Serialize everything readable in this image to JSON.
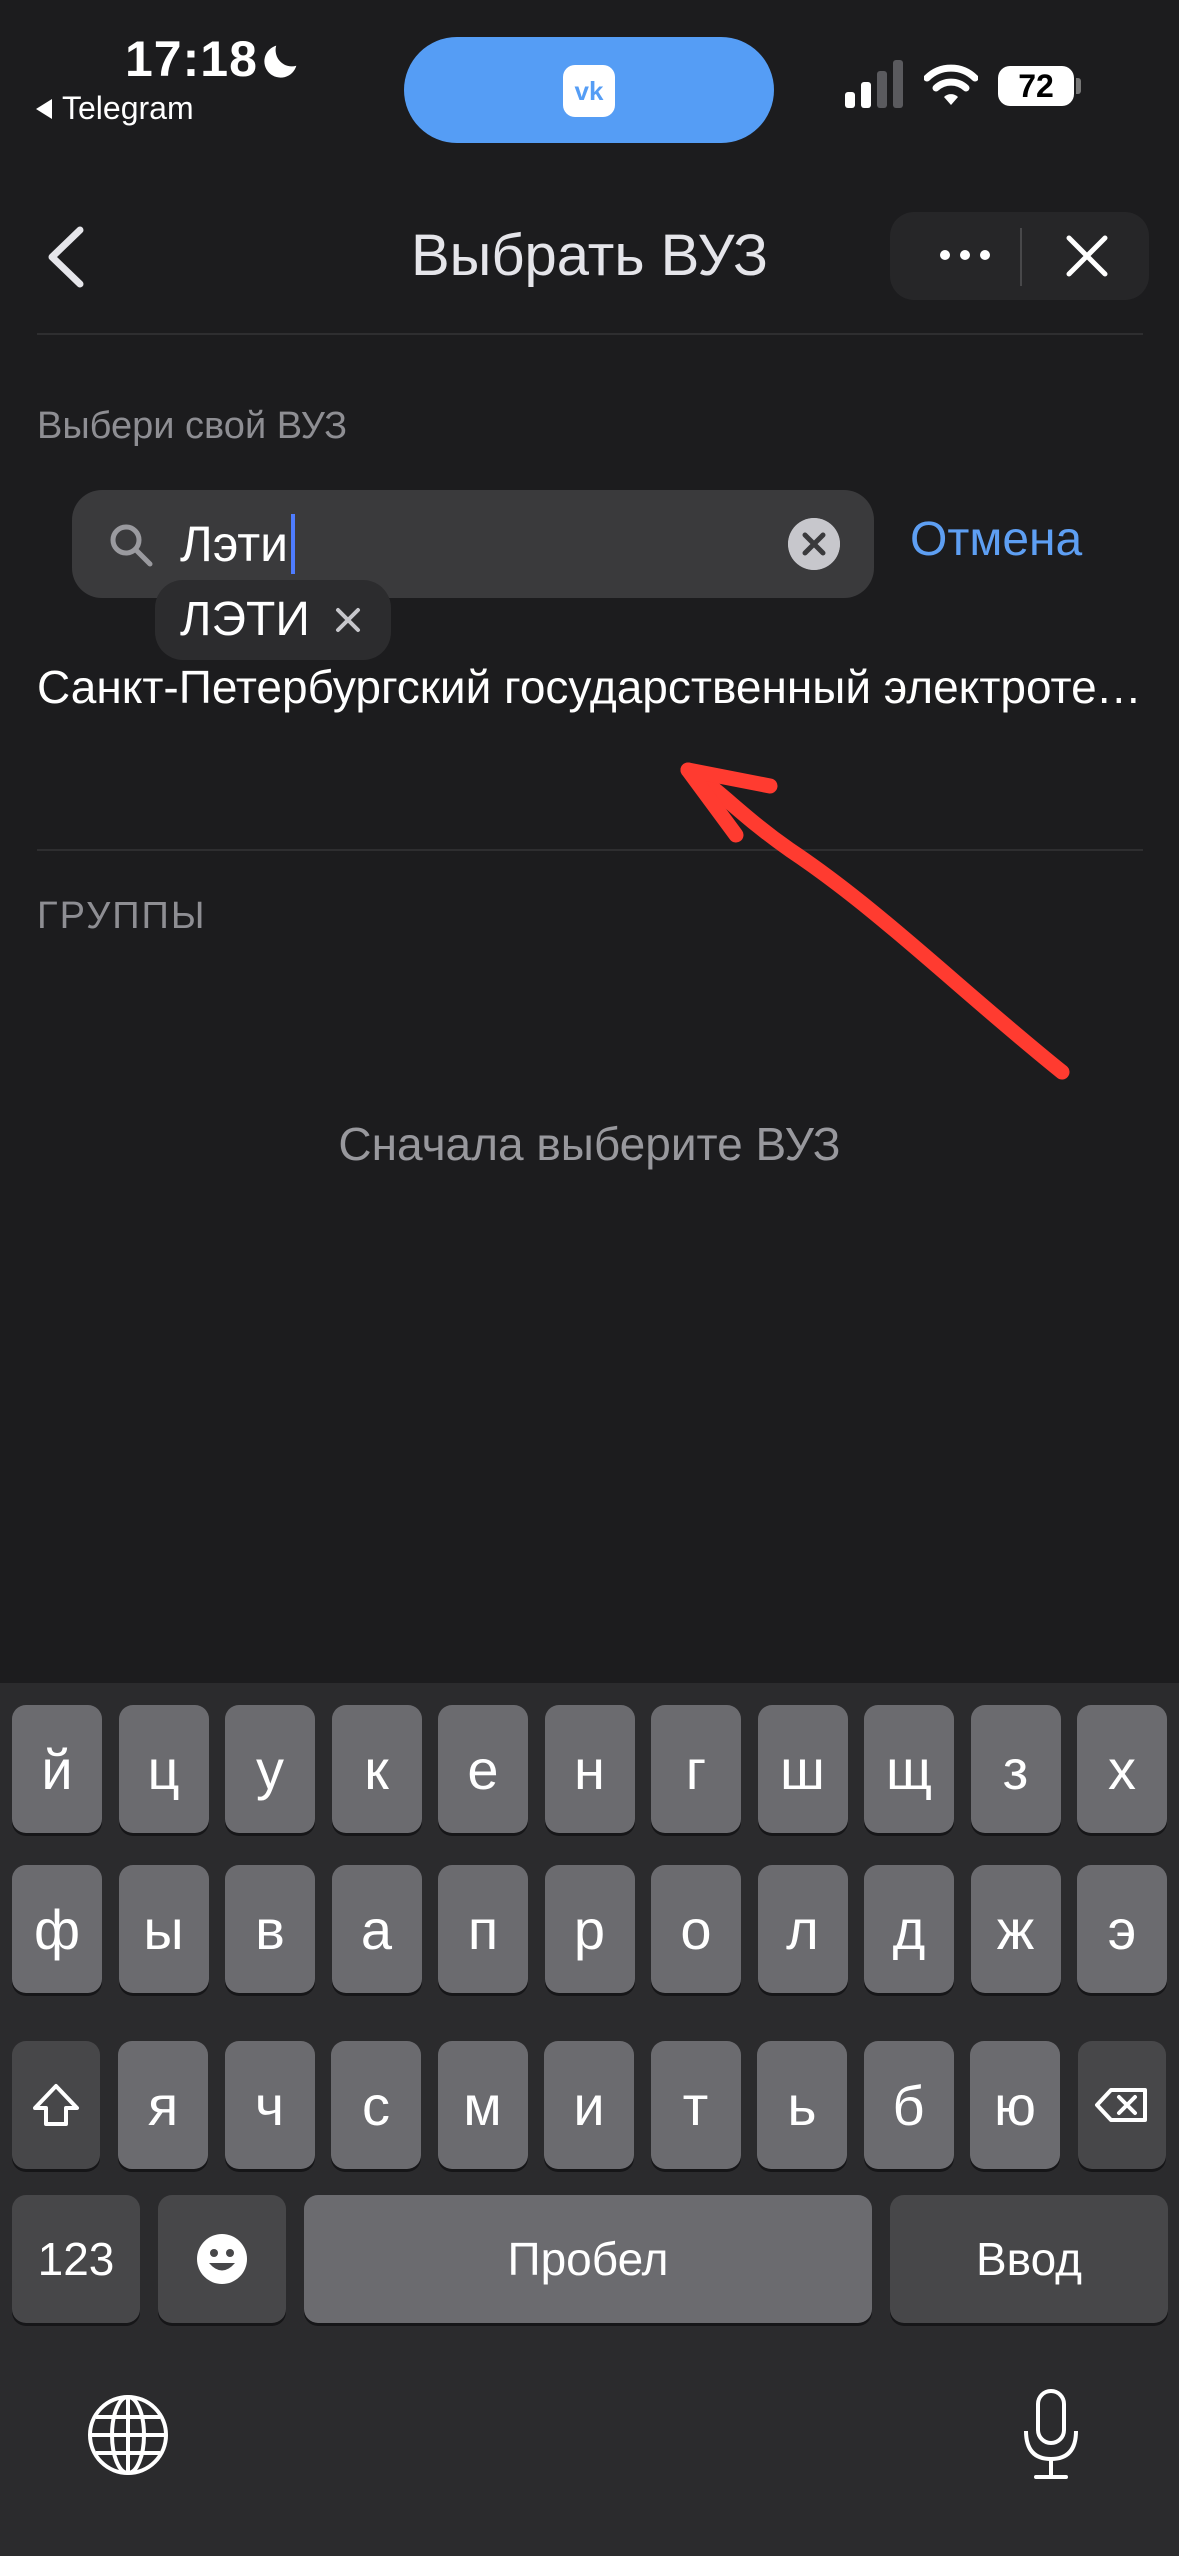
{
  "status_bar": {
    "time": "17:18",
    "back_app": "Telegram",
    "battery": "72"
  },
  "header": {
    "title": "Выбрать ВУЗ"
  },
  "university_section": {
    "label": "Выбери свой ВУЗ"
  },
  "search": {
    "value": "Лэти",
    "cancel": "Отмена"
  },
  "suggestion_chip": {
    "label": "ЛЭТИ"
  },
  "results": [
    {
      "name": "Санкт-Петербургский государственный электротехнический университет «ЛЭТИ»"
    }
  ],
  "groups_section": {
    "label": "ГРУППЫ",
    "empty_text": "Сначала выберите ВУЗ"
  },
  "annotation": {
    "arrow_color": "#ff3b30"
  },
  "keyboard": {
    "row1": [
      "й",
      "ц",
      "у",
      "к",
      "е",
      "н",
      "г",
      "ш",
      "щ",
      "з",
      "х"
    ],
    "row2": [
      "ф",
      "ы",
      "в",
      "а",
      "п",
      "р",
      "о",
      "л",
      "д",
      "ж",
      "э"
    ],
    "row3": [
      "я",
      "ч",
      "с",
      "м",
      "и",
      "т",
      "ь",
      "б",
      "ю"
    ],
    "numbers_key": "123",
    "space_key": "Пробел",
    "return_key": "Ввод"
  },
  "colors": {
    "accent": "#5e9ff3",
    "island": "#559df5",
    "background": "#1c1c1e"
  }
}
